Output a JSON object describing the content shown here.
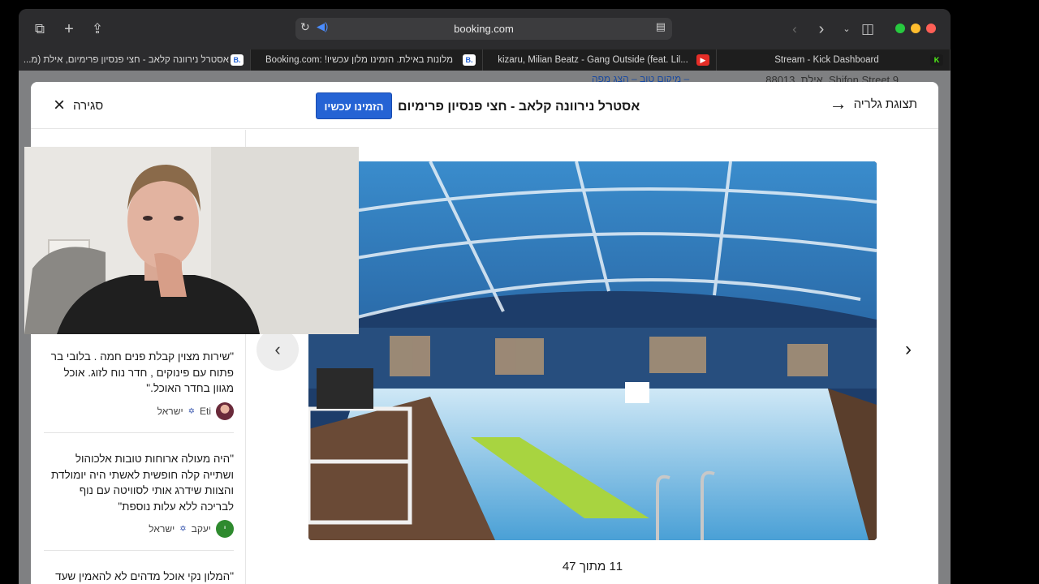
{
  "browser": {
    "address": "booking.com",
    "tabs": [
      {
        "label": "אסטרל נירוונה קלאב - חצי פנסיון פרימיום, אילת (מ...",
        "favicon": "B.",
        "active": true
      },
      {
        "label": "מלונות באילת. הזמינו מלון עכשיו! :Booking.com",
        "favicon": "B.",
        "active": false
      },
      {
        "label": "kizaru, Milian Beatz - Gang Outside (feat. Lil...",
        "favicon": "▶",
        "active": false
      },
      {
        "label": "Stream - Kick Dashboard",
        "favicon": "K",
        "active": false
      }
    ]
  },
  "background_page": {
    "address": "Shifon Street 9, אילת, 88013",
    "map_link": "– מיקום טוב – הצג מפה"
  },
  "modal": {
    "close_label": "סגירה",
    "book_button": "הזמינו עכשיו",
    "title": "אסטרל נירוונה קלאב - חצי פנסיון פרימיום",
    "gallery_label": "תצוגת גלריה",
    "photo_counter": "11 מתוך 47",
    "selected_thumbnail": 6
  },
  "reviews": [
    {
      "text": "\"שירות מצוין קבלת פנים חמה . בלובי בר פתוח עם פינוקים , חדר נוח לזוג. אוכל מגוון בחדר האוכל.\"",
      "name": "Eti",
      "country": "ישראל",
      "avatar_initial": ""
    },
    {
      "text": "\"היה מעולה ארוחות טובות אלכוהול ושתייה קלה חופשית לאשתי היה יומולדת והצוות שידרג אותי לסוויטה עם נוף לבריכה ללא עלות נוספת\"",
      "name": "יעקב",
      "country": "ישראל",
      "avatar_initial": "י"
    },
    {
      "text": "\"המלון נקי אוכל מדהים לא להאמין שעד עכשיו לא הגענו לפה, פשוט אבל מושג\"",
      "name": "",
      "country": "",
      "avatar_initial": ""
    }
  ],
  "colors": {
    "brand_blue": "#2563d4",
    "avatar_green": "#2e8a2e",
    "youtube_red": "#e52d27",
    "kick_green": "#53fc18"
  }
}
